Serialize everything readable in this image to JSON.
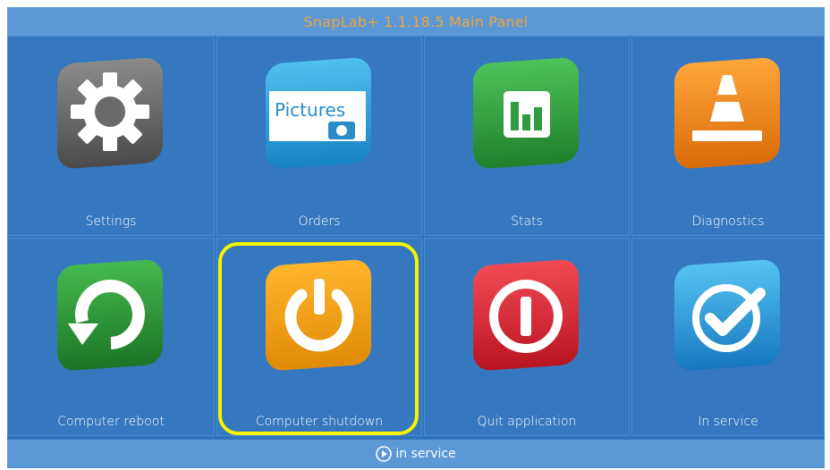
{
  "window": {
    "title": "SnapLab+ 1.1.18.5 Main Panel"
  },
  "tiles": [
    {
      "label": "Settings",
      "icon": "gear-icon",
      "color": "#6b6b6b"
    },
    {
      "label": "Orders",
      "icon": "pictures-folder-icon",
      "color": "#2aa3d8",
      "icon_text": "Pictures"
    },
    {
      "label": "Stats",
      "icon": "bar-chart-icon",
      "color": "#2f9c3f"
    },
    {
      "label": "Diagnostics",
      "icon": "traffic-cone-icon",
      "color": "#f08a1c"
    },
    {
      "label": "Computer reboot",
      "icon": "reboot-arrow-icon",
      "color": "#2f9a35"
    },
    {
      "label": "Computer shutdown",
      "icon": "power-icon",
      "color": "#f2a21a"
    },
    {
      "label": "Quit application",
      "icon": "exit-icon",
      "color": "#e02a36"
    },
    {
      "label": "In service",
      "icon": "checkmark-icon",
      "color": "#2a93d6"
    }
  ],
  "footer": {
    "status": "in service",
    "icon": "play-circle-icon"
  },
  "highlight_color": "#f5f500"
}
